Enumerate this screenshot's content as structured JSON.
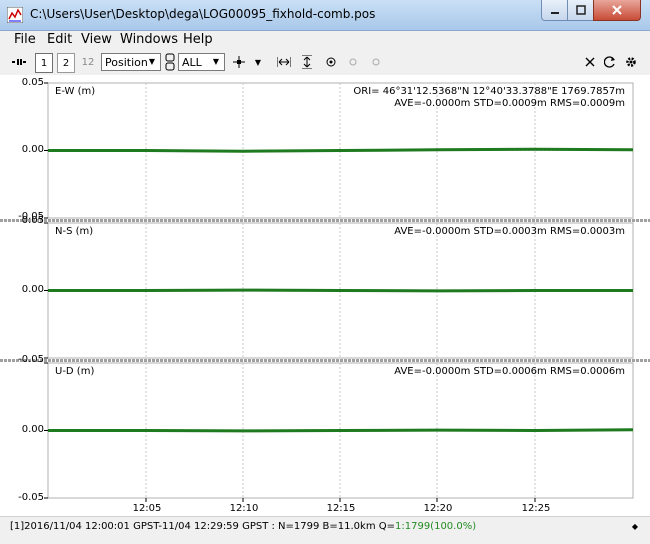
{
  "window": {
    "title": "C:\\Users\\User\\Desktop\\dega\\LOG00095_fixhold-comb.pos",
    "minimize_icon": "minimize-icon",
    "maximize_icon": "maximize-icon",
    "close_icon": "close-icon"
  },
  "menu": {
    "file": "File",
    "edit": "Edit",
    "view": "View",
    "windows": "Windows",
    "help": "Help"
  },
  "toolbar": {
    "btn1": "1",
    "btn2": "2",
    "btn12": "12",
    "plot_type": "Position",
    "quality": "ALL"
  },
  "plot": {
    "colors": {
      "series": "#1e7a1e",
      "grid": "#c8c8c8",
      "separator": "#a0a0a0"
    },
    "x_ticks": [
      "12:05",
      "12:10",
      "12:15",
      "12:20",
      "12:25"
    ],
    "panels": [
      {
        "title": "E-W (m)",
        "origin": "ORI= 46°31'12.5368\"N   12°40'33.3788\"E 1769.7857m",
        "stats": "AVE=-0.0000m STD=0.0009m RMS=0.0009m",
        "y_ticks": [
          "0.05",
          "0.00",
          "-0.05"
        ]
      },
      {
        "title": "N-S (m)",
        "origin": "",
        "stats": "AVE=-0.0000m STD=0.0003m RMS=0.0003m",
        "y_ticks": [
          "0.05",
          "0.00",
          "-0.05"
        ]
      },
      {
        "title": "U-D (m)",
        "origin": "",
        "stats": "AVE=-0.0000m STD=0.0006m RMS=0.0006m",
        "y_ticks": [
          "0.05",
          "0.00",
          "-0.05"
        ]
      }
    ]
  },
  "chart_data": {
    "type": "line",
    "title": "",
    "x": [
      "12:00:01",
      "12:05",
      "12:10",
      "12:15",
      "12:20",
      "12:25",
      "12:29:59"
    ],
    "xlabel": "",
    "ylim": [
      -0.05,
      0.05
    ],
    "series": [
      {
        "name": "E-W (m)",
        "values": [
          0.0,
          0.0,
          -0.0005,
          0.0,
          0.0005,
          0.001,
          0.0005
        ]
      },
      {
        "name": "N-S (m)",
        "values": [
          0.0,
          0.0,
          0.0003,
          0.0,
          -0.0003,
          0.0,
          0.0
        ]
      },
      {
        "name": "U-D (m)",
        "values": [
          0.0,
          0.0,
          -0.0003,
          0.0,
          0.0003,
          0.0,
          0.0005
        ]
      }
    ]
  },
  "status": {
    "text": "[1]2016/11/04 12:00:01 GPST-11/04 12:29:59 GPST : N=1799 B=11.0km Q=",
    "q_value": "1:1799(100.0%)",
    "marker": "◆"
  }
}
